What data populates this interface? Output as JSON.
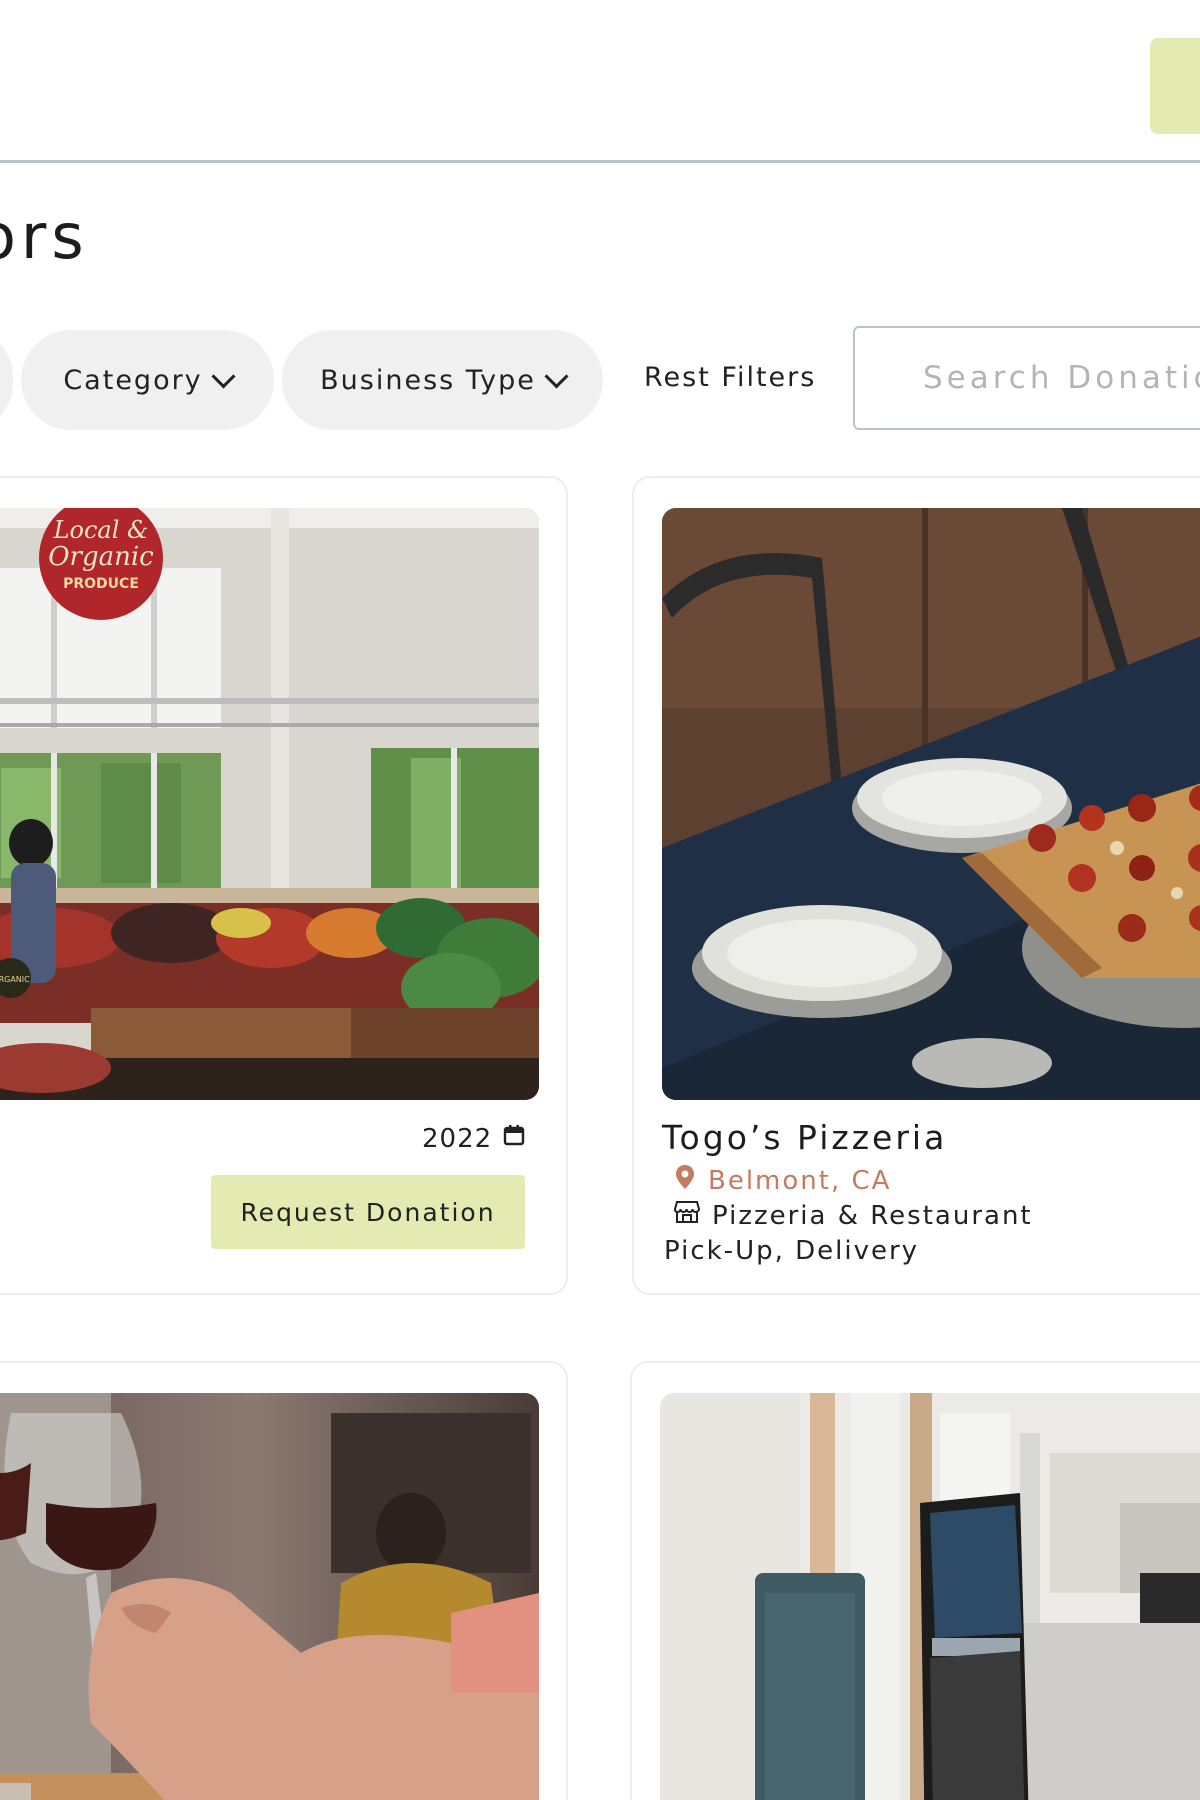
{
  "header": {
    "page_title": "ors"
  },
  "filters": {
    "category_label": "Category",
    "business_type_label": "Business Type",
    "reset_label": "Rest Filters",
    "search_placeholder": "Search Donatio"
  },
  "listings": [
    {
      "year": "2022",
      "request_label": "Request Donation"
    },
    {
      "name": "Togo’s Pizzeria",
      "location": "Belmont, CA",
      "business_type": "Pizzeria & Restaurant",
      "fulfillment": "Pick-Up, Delivery"
    }
  ],
  "photo_labels": {
    "sign_line1": "Local &",
    "sign_line2": "Organic",
    "sign_line3": "PRODUCE",
    "organic_badge": "ORGANIC"
  },
  "icons": {
    "calendar": "calendar-icon",
    "location": "map-pin-icon",
    "business": "storefront-icon",
    "dropdown": "chevron-down-icon"
  },
  "colors": {
    "accent": "#e3ebb3",
    "location_text": "#c47b62",
    "border": "#b8c3cc",
    "pill_bg": "#f0f0f0"
  }
}
